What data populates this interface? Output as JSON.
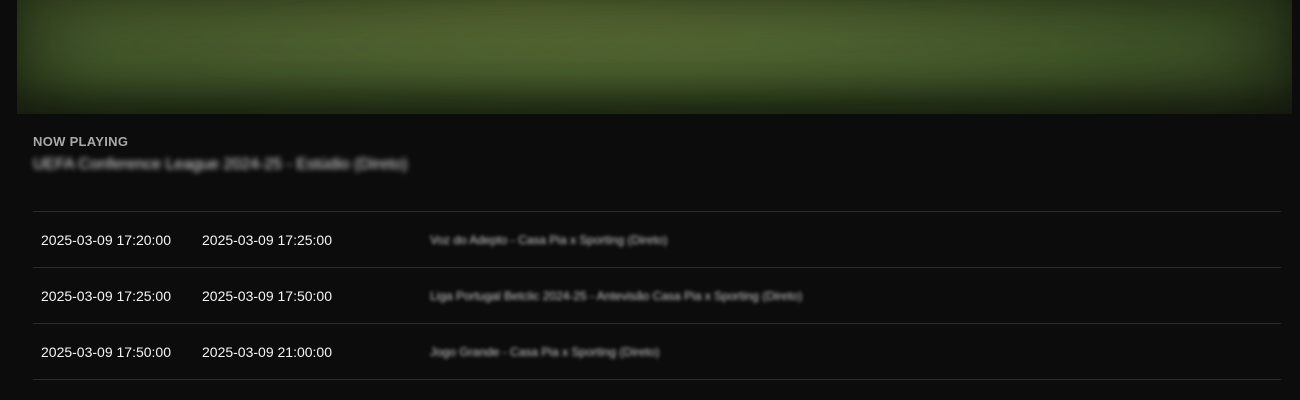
{
  "player": {
    "now_playing_label": "NOW PLAYING",
    "now_playing_title": "UEFA Conference League 2024-25 - Estúdio (Direto)"
  },
  "schedule": {
    "rows": [
      {
        "start": "2025-03-09 17:20:00",
        "end": "2025-03-09 17:25:00",
        "title": "Voz do Adepto - Casa Pia x Sporting (Direto)"
      },
      {
        "start": "2025-03-09 17:25:00",
        "end": "2025-03-09 17:50:00",
        "title": "Liga Portugal Betclic 2024-25 - Antevisão Casa Pia x Sporting (Direto)"
      },
      {
        "start": "2025-03-09 17:50:00",
        "end": "2025-03-09 21:00:00",
        "title": "Jogo Grande - Casa Pia x Sporting (Direto)"
      }
    ]
  },
  "colors": {
    "background": "#0c0c0c",
    "video_tint": "#4a5e2e",
    "divider": "#2c2c2c",
    "label_gray": "#a9a9a9"
  }
}
